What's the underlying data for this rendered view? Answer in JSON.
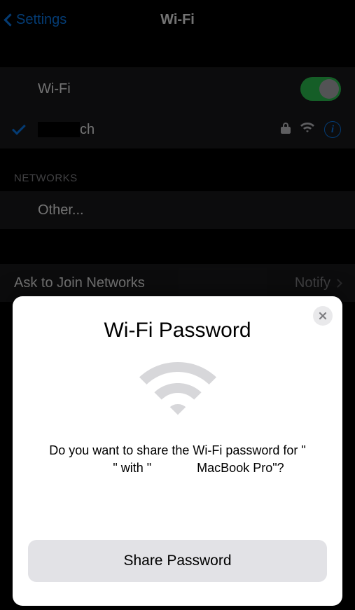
{
  "nav": {
    "back_label": "Settings",
    "title": "Wi-Fi"
  },
  "wifi": {
    "row_label": "Wi-Fi",
    "enabled": true,
    "connected_network_suffix": "ch"
  },
  "sections": {
    "networks_header": "NETWORKS",
    "other_label": "Other..."
  },
  "ask_join": {
    "label": "Ask to Join Networks",
    "value": "Notify"
  },
  "modal": {
    "title": "Wi-Fi Password",
    "prompt_prefix": "Do you want to share the Wi-Fi password for",
    "prompt_mid": "with",
    "prompt_device_suffix": "MacBook Pro",
    "share_button": "Share Password"
  }
}
